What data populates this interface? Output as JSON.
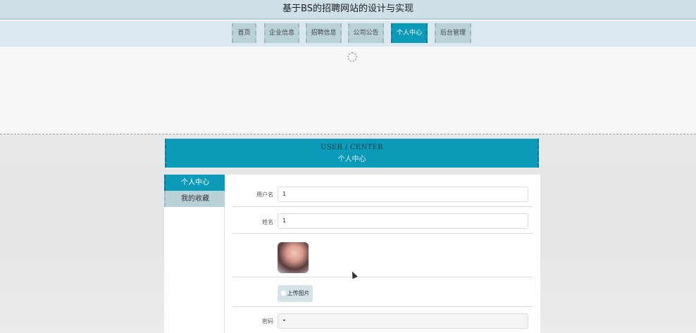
{
  "site": {
    "title": "基于BS的招聘网站的设计与实现"
  },
  "nav": {
    "items": [
      {
        "label": "首页"
      },
      {
        "label": "企业信息"
      },
      {
        "label": "招聘信息"
      },
      {
        "label": "公司公告"
      },
      {
        "label": "个人中心",
        "active": true
      },
      {
        "label": "后台管理"
      }
    ]
  },
  "center": {
    "title_en": "USER / CENTER",
    "title_cn": "个人中心"
  },
  "side_menu": {
    "items": [
      {
        "label": "个人中心",
        "active": true
      },
      {
        "label": "我的收藏"
      }
    ]
  },
  "form": {
    "username_label": "用户名",
    "username_value": "1",
    "name_label": "姓名",
    "name_value": "1",
    "upload_label": "上传图片",
    "password_label": "密码",
    "password_value": "•"
  },
  "colors": {
    "accent": "#0b9bb8",
    "nav_bg": "#b9d2d8",
    "header_bg": "#cfe0e6"
  }
}
